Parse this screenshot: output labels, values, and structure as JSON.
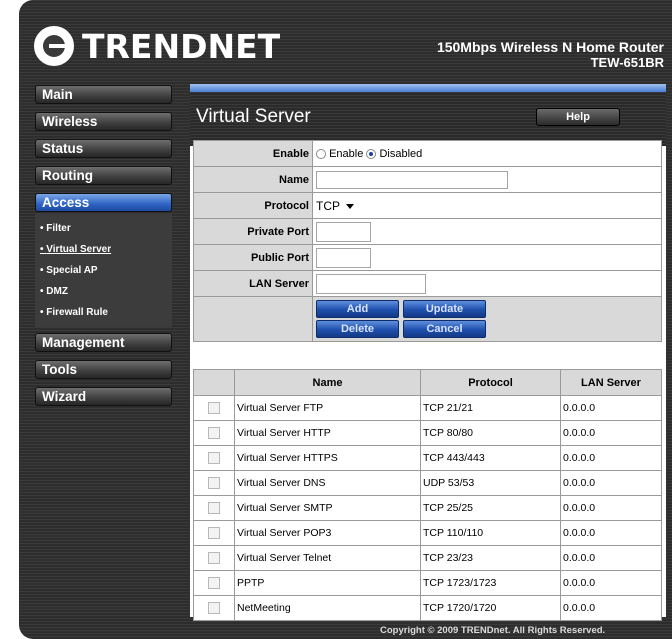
{
  "brand": {
    "logo_text": "TRENDNET",
    "product_name": "150Mbps Wireless N Home Router",
    "model": "TEW-651BR"
  },
  "nav": {
    "main": "Main",
    "wireless": "Wireless",
    "status": "Status",
    "routing": "Routing",
    "access": "Access",
    "access_items": [
      "Filter",
      "Virtual Server",
      "Special AP",
      "DMZ",
      "Firewall Rule"
    ],
    "management": "Management",
    "tools": "Tools",
    "wizard": "Wizard"
  },
  "page": {
    "title": "Virtual Server",
    "help_label": "Help"
  },
  "form": {
    "enable_label": "Enable",
    "enable_option": "Enable",
    "disabled_option": "Disabled",
    "selected": "Disabled",
    "name_label": "Name",
    "name_value": "",
    "protocol_label": "Protocol",
    "protocol_value": "TCP",
    "private_port_label": "Private Port",
    "private_port_value": "",
    "public_port_label": "Public Port",
    "public_port_value": "",
    "lan_server_label": "LAN Server",
    "lan_server_value": "",
    "add_label": "Add",
    "update_label": "Update",
    "delete_label": "Delete",
    "cancel_label": "Cancel"
  },
  "table": {
    "headers": [
      "",
      "Name",
      "Protocol",
      "LAN Server"
    ],
    "rows": [
      {
        "name": "Virtual Server FTP",
        "protocol": "TCP 21/21",
        "lan": "0.0.0.0"
      },
      {
        "name": "Virtual Server HTTP",
        "protocol": "TCP 80/80",
        "lan": "0.0.0.0"
      },
      {
        "name": "Virtual Server HTTPS",
        "protocol": "TCP 443/443",
        "lan": "0.0.0.0"
      },
      {
        "name": "Virtual Server DNS",
        "protocol": "UDP 53/53",
        "lan": "0.0.0.0"
      },
      {
        "name": "Virtual Server SMTP",
        "protocol": "TCP 25/25",
        "lan": "0.0.0.0"
      },
      {
        "name": "Virtual Server POP3",
        "protocol": "TCP 110/110",
        "lan": "0.0.0.0"
      },
      {
        "name": "Virtual Server Telnet",
        "protocol": "TCP 23/23",
        "lan": "0.0.0.0"
      },
      {
        "name": "PPTP",
        "protocol": "TCP 1723/1723",
        "lan": "0.0.0.0"
      },
      {
        "name": "NetMeeting",
        "protocol": "TCP 1720/1720",
        "lan": "0.0.0.0"
      }
    ]
  },
  "footer": {
    "copyright": "Copyright © 2009 TRENDnet. All Rights Reserved."
  },
  "colors": {
    "accent": "#2e63c4",
    "frame": "#333333",
    "label_bg": "#d9d9d9"
  }
}
